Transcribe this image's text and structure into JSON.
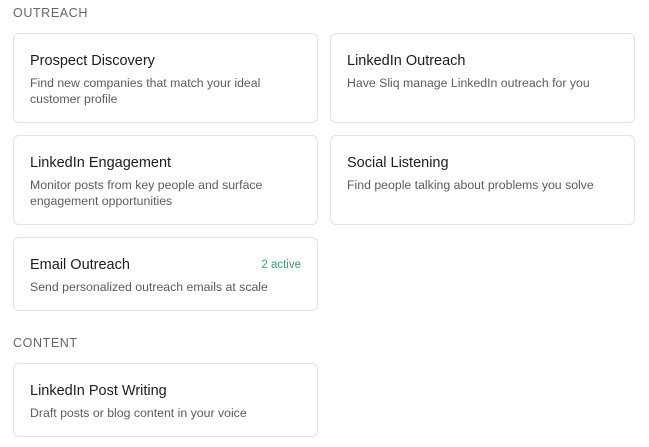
{
  "sections": [
    {
      "title": "OUTREACH",
      "cards": [
        {
          "title": "Prospect Discovery",
          "description": "Find new companies that match your ideal customer profile"
        },
        {
          "title": "LinkedIn Outreach",
          "description": "Have Sliq manage LinkedIn outreach for you"
        },
        {
          "title": "LinkedIn Engagement",
          "description": "Monitor posts from key people and surface engagement opportunities"
        },
        {
          "title": "Social Listening",
          "description": "Find people talking about problems you solve"
        },
        {
          "title": "Email Outreach",
          "description": "Send personalized outreach emails at scale",
          "badge": "2 active"
        }
      ]
    },
    {
      "title": "CONTENT",
      "cards": [
        {
          "title": "LinkedIn Post Writing",
          "description": "Draft posts or blog content in your voice"
        }
      ]
    }
  ],
  "colors": {
    "badge": "#3aa66a",
    "card_border": "#e3e3e3",
    "section_label": "#666666"
  }
}
